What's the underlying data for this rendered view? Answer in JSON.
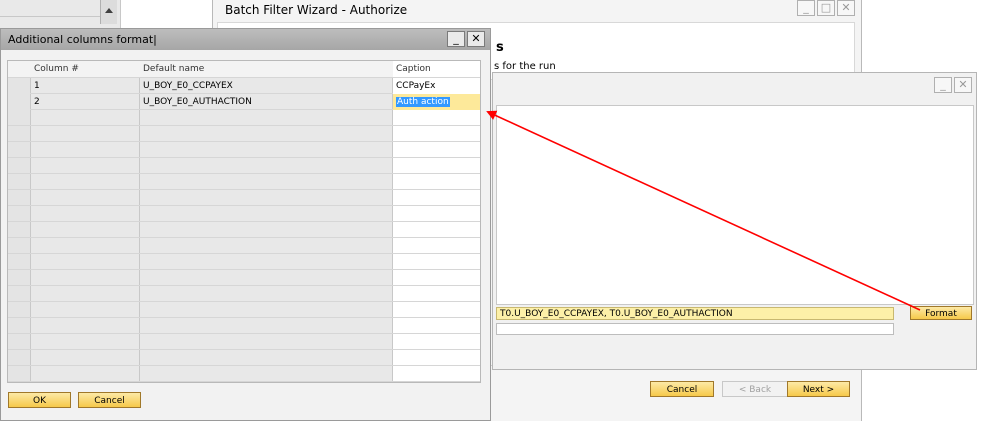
{
  "wizard": {
    "title": "Batch Filter Wizard - Authorize",
    "header_title": "s",
    "header_subtitle": "s for the run",
    "cancel_label": "Cancel",
    "back_label": "< Back",
    "next_label": "Next >"
  },
  "inner_dialog": {
    "columns_value": "T0.U_BOY_E0_CCPAYEX, T0.U_BOY_E0_AUTHACTION",
    "format_label": "Format"
  },
  "acf": {
    "title": "Additional columns format|",
    "headers": {
      "col_num": "Column #",
      "default_name": "Default name",
      "caption": "Caption"
    },
    "rows": [
      {
        "num": "1",
        "name": "U_BOY_E0_CCPAYEX",
        "caption": "CCPayEx"
      },
      {
        "num": "2",
        "name": "U_BOY_E0_AUTHACTION",
        "caption": "Auth action"
      }
    ],
    "ok_label": "OK",
    "cancel_label": "Cancel"
  },
  "colors": {
    "accent_yellow": "#f6c94a",
    "selection_blue": "#3399ff",
    "arrow_red": "#ff0000"
  }
}
